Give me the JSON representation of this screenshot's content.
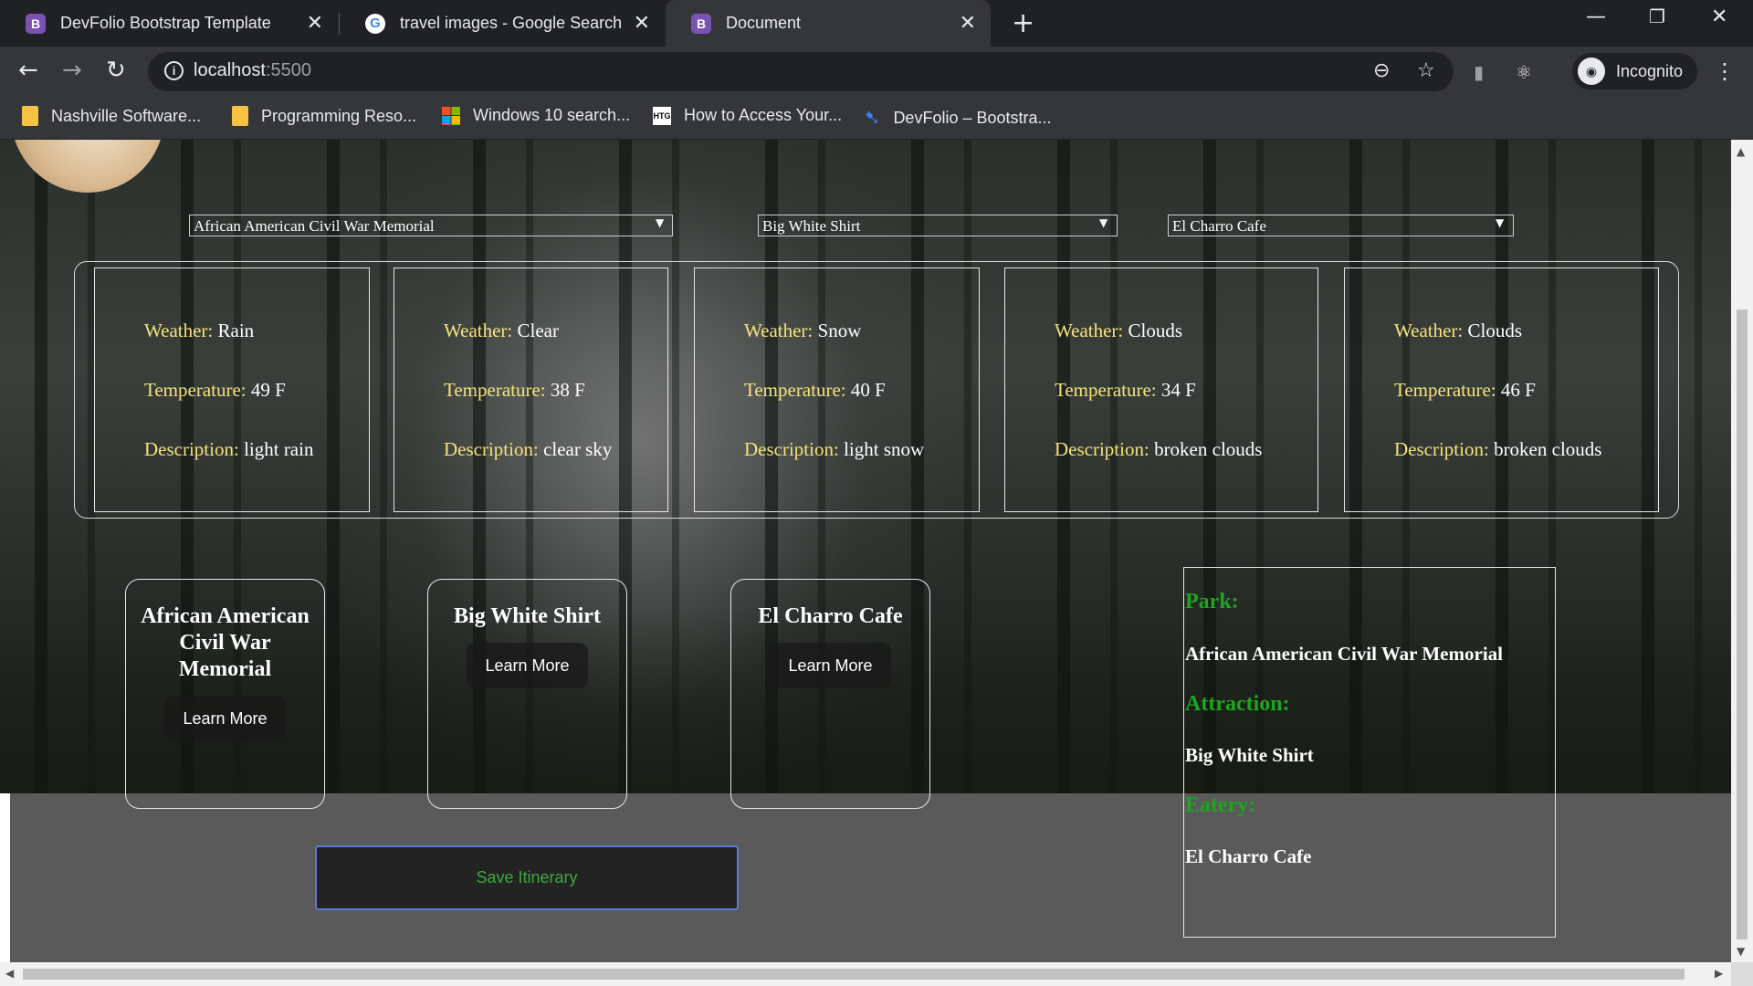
{
  "browser": {
    "tabs": [
      {
        "title": "DevFolio Bootstrap Template",
        "favicon": "B",
        "active": false
      },
      {
        "title": "travel images - Google Search",
        "favicon": "G",
        "active": false
      },
      {
        "title": "Document",
        "favicon": "B",
        "active": true
      }
    ],
    "url_host": "localhost",
    "url_port": ":5500",
    "profile_label": "Incognito",
    "bookmarks": [
      {
        "label": "Nashville Software...",
        "icon": "folder-icon"
      },
      {
        "label": "Programming Reso...",
        "icon": "folder-icon"
      },
      {
        "label": "Windows 10 search...",
        "icon": "windows-icon"
      },
      {
        "label": "How to Access Your...",
        "icon": "htg-icon"
      },
      {
        "label": "DevFolio – Bootstra...",
        "icon": "devfolio-icon"
      }
    ],
    "htg_text": "HTG"
  },
  "selects": {
    "park": "African American Civil War Memorial",
    "attraction": "Big White Shirt",
    "eatery": "El Charro Cafe"
  },
  "weather": [
    {
      "weather": "Rain",
      "temperature": "49 F",
      "description": "light rain"
    },
    {
      "weather": "Clear",
      "temperature": "38 F",
      "description": "clear sky"
    },
    {
      "weather": "Snow",
      "temperature": "40 F",
      "description": "light snow"
    },
    {
      "weather": "Clouds",
      "temperature": "34 F",
      "description": "broken clouds"
    },
    {
      "weather": "Clouds",
      "temperature": "46 F",
      "description": "broken clouds"
    }
  ],
  "weather_labels": {
    "weather": "Weather:",
    "temperature": "Temperature:",
    "description": "Description:"
  },
  "cards": [
    {
      "title": "African American Civil War Memorial",
      "button": "Learn More"
    },
    {
      "title": "Big White Shirt",
      "button": "Learn More"
    },
    {
      "title": "El Charro Cafe",
      "button": "Learn More"
    }
  ],
  "save_button": "Save Itinerary",
  "itinerary": {
    "park_label": "Park:",
    "park": "African American Civil War Memorial",
    "attraction_label": "Attraction:",
    "attraction": "Big White Shirt",
    "eatery_label": "Eatery:",
    "eatery": "El Charro Cafe"
  },
  "colors": {
    "label_yellow": "#f6e27a",
    "label_green": "#1fa51f",
    "save_text": "#3ea83e"
  }
}
